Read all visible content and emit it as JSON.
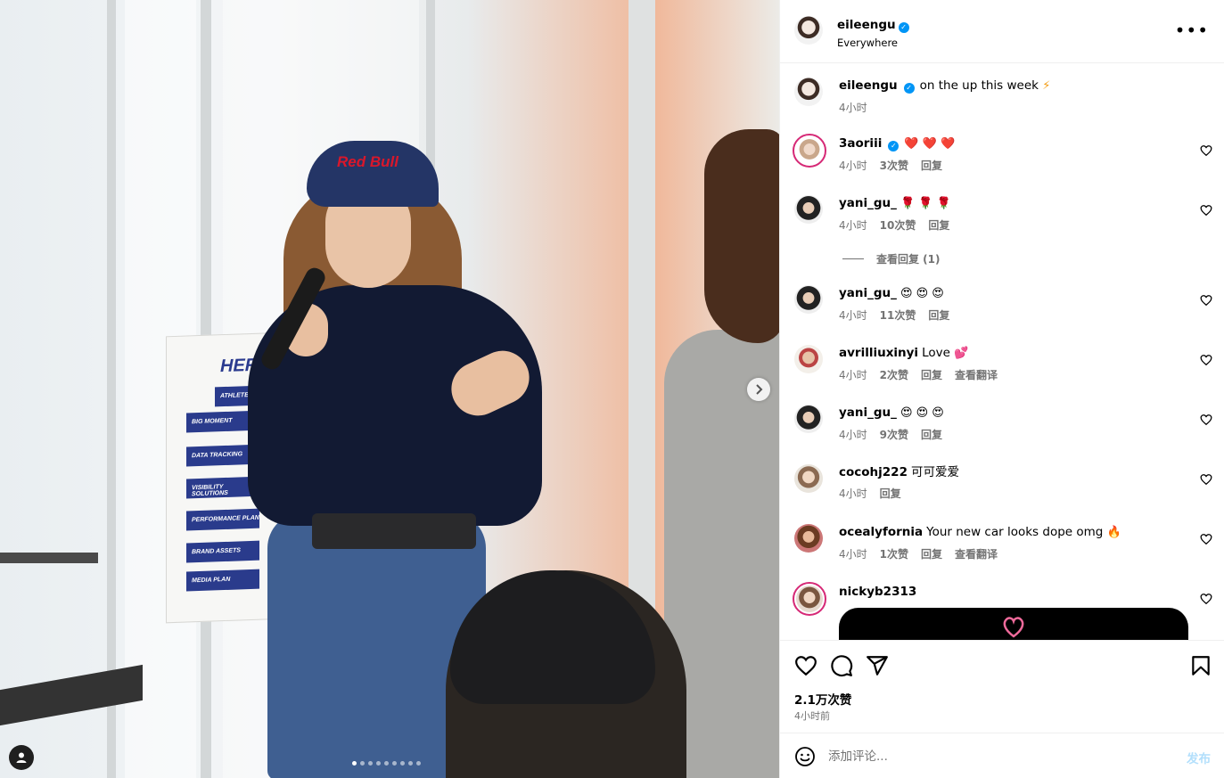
{
  "post": {
    "author": "eileengu",
    "location": "Everywhere",
    "caption": "on the up this week",
    "caption_emoji": "⚡",
    "caption_time": "4小时",
    "likes": "2.1万次赞",
    "time_ago": "4小时前",
    "image_count": 9,
    "active_image": 1
  },
  "photo": {
    "cap_logo": "Red Bull",
    "sign_title": "HERO PL",
    "sign_rows": [
      "ATHLETE NAM",
      "BIG MOMENT",
      "DATA TRACKING",
      "VISIBILITY SOLUTIONS",
      "PERFORMANCE PLAN",
      "BRAND ASSETS",
      "MEDIA PLAN"
    ]
  },
  "comments": [
    {
      "user": "3aoriii",
      "verified": true,
      "text": "",
      "emoji": "❤️ ❤️ ❤️",
      "time": "4小时",
      "likes": "3次赞",
      "reply": "回复",
      "translate": ""
    },
    {
      "user": "yani_gu_",
      "verified": false,
      "text": "",
      "emoji": "🌹 🌹 🌹",
      "time": "4小时",
      "likes": "10次赞",
      "reply": "回复",
      "translate": "",
      "view_replies": "查看回复 (1)"
    },
    {
      "user": "yani_gu_",
      "verified": false,
      "text": "",
      "emoji": "😍 😍 😍",
      "time": "4小时",
      "likes": "11次赞",
      "reply": "回复",
      "translate": ""
    },
    {
      "user": "avrilliuxinyi",
      "verified": false,
      "text": "Love",
      "emoji": "💕",
      "time": "4小时",
      "likes": "2次赞",
      "reply": "回复",
      "translate": "查看翻译"
    },
    {
      "user": "yani_gu_",
      "verified": false,
      "text": "",
      "emoji": "😍 😍 😍",
      "time": "4小时",
      "likes": "9次赞",
      "reply": "回复",
      "translate": ""
    },
    {
      "user": "cocohj222",
      "verified": false,
      "text": "可可爱爱",
      "emoji": "",
      "time": "4小时",
      "likes": "",
      "reply": "回复",
      "translate": ""
    },
    {
      "user": "ocealyfornia",
      "verified": false,
      "text": "Your new car looks dope omg",
      "emoji": "🔥",
      "time": "4小时",
      "likes": "1次赞",
      "reply": "回复",
      "translate": "查看翻译"
    },
    {
      "user": "nickyb2313",
      "verified": false,
      "text": "",
      "emoji": "",
      "time": "",
      "likes": "",
      "reply": "",
      "translate": ""
    }
  ],
  "comment_box": {
    "placeholder": "添加评论...",
    "post_label": "发布"
  },
  "colors": {
    "verified": "#0095f6",
    "muted": "#737373",
    "post_disabled": "#b2dffc",
    "story_ring": "#d62976"
  },
  "icons": {
    "like": "heart-outline-icon",
    "comment": "speech-bubble-icon",
    "share": "paper-plane-icon",
    "save": "bookmark-icon",
    "more": "more-horizontal-icon",
    "next": "chevron-right-icon",
    "tag": "person-icon",
    "emoji": "smiley-icon"
  }
}
